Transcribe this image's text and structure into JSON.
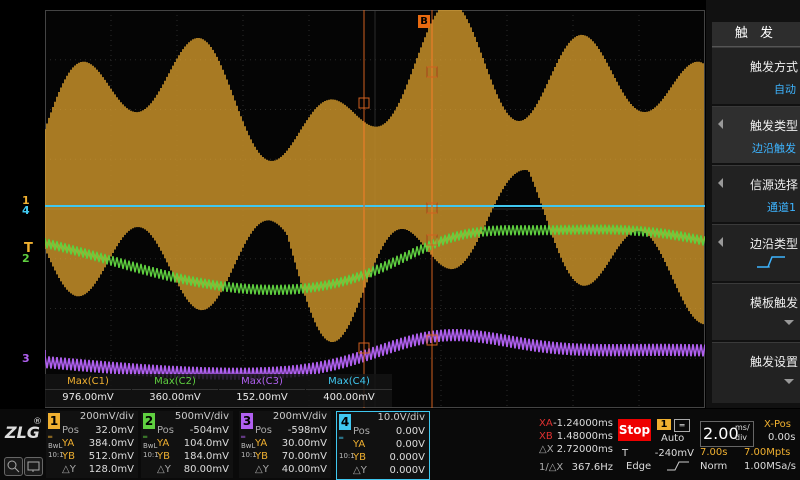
{
  "menu": {
    "title": "触 发",
    "items": [
      {
        "label": "触发方式",
        "value": "自动",
        "arrow": false,
        "down": false
      },
      {
        "label": "触发类型",
        "value": "边沿触发",
        "arrow": true,
        "down": false
      },
      {
        "label": "信源选择",
        "value": "通道1",
        "arrow": true,
        "down": false
      },
      {
        "label": "边沿类型",
        "value": "",
        "arrow": true,
        "down": false
      },
      {
        "label": "模板触发",
        "value": "",
        "arrow": false,
        "down": true
      },
      {
        "label": "触发设置",
        "value": "",
        "arrow": false,
        "down": true
      }
    ]
  },
  "cursor_marker": "B",
  "channel_markers": [
    "1",
    "4",
    "T",
    "2",
    "3"
  ],
  "measurements": [
    {
      "name": "Max(C1)",
      "value": "976.00mV",
      "color": "#f0b030"
    },
    {
      "name": "Max(C2)",
      "value": "360.00mV",
      "color": "#5fd040"
    },
    {
      "name": "Max(C3)",
      "value": "152.00mV",
      "color": "#b060f0"
    },
    {
      "name": "Max(C4)",
      "value": "400.00mV",
      "color": "#40c8f0"
    }
  ],
  "logo": "ZLG",
  "logo_mark": "®",
  "channels": [
    {
      "num": "1",
      "color": "#f0b030",
      "vdiv": "200mV/div",
      "pos": "32.0mV",
      "ya": "384.0mV",
      "yb": "512.0mV",
      "dy": "128.0mV",
      "cpl": "BwL",
      "ratio": "10:1"
    },
    {
      "num": "2",
      "color": "#5fd040",
      "vdiv": "500mV/div",
      "pos": "-504mV",
      "ya": "104.0mV",
      "yb": "184.0mV",
      "dy": "80.00mV",
      "cpl": "BwL",
      "ratio": "10:1"
    },
    {
      "num": "3",
      "color": "#b060f0",
      "vdiv": "200mV/div",
      "pos": "-598mV",
      "ya": "30.00mV",
      "yb": "70.00mV",
      "dy": "40.00mV",
      "cpl": "BwL",
      "ratio": "10:1"
    },
    {
      "num": "4",
      "color": "#40c8f0",
      "vdiv": "10.0V/div",
      "pos": "0.00V",
      "ya": "0.00V",
      "yb": "0.000V",
      "dy": "0.000V",
      "cpl": "",
      "ratio": "10:1"
    }
  ],
  "row_labels": {
    "pos": "Pos",
    "ya": "YA",
    "yb": "YB",
    "dy": "△Y"
  },
  "cursors": {
    "xa_label": "XA",
    "xa": "-1.24000ms",
    "xb_label": "XB",
    "xb": "1.48000ms",
    "dx_label": "△X",
    "dx": "2.72000ms",
    "inv_label": "1/△X",
    "inv": "367.6Hz"
  },
  "run_state": "Stop",
  "trigger": {
    "channel": "1",
    "mode": "Auto",
    "level_label": "T",
    "level": "-240mV",
    "type": "Edge"
  },
  "timebase": {
    "value": "2.00",
    "unit_top": "ms/",
    "unit_bot": "div",
    "xpos_label": "X-Pos",
    "xpos": "0.00s",
    "time": "7.00s",
    "points": "7.00Mpts",
    "acq": "Norm",
    "rate": "1.00MSa/s"
  }
}
